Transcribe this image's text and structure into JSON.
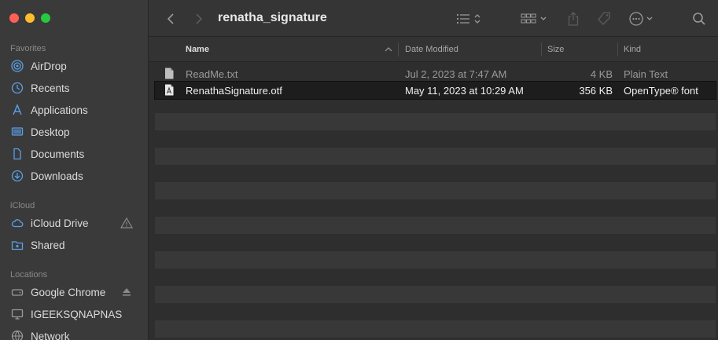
{
  "window": {
    "title": "renatha_signature"
  },
  "sidebar": {
    "sections": [
      {
        "title": "Favorites",
        "items": [
          {
            "label": "AirDrop",
            "icon": "airdrop-icon"
          },
          {
            "label": "Recents",
            "icon": "clock-icon"
          },
          {
            "label": "Applications",
            "icon": "applications-icon"
          },
          {
            "label": "Desktop",
            "icon": "desktop-icon"
          },
          {
            "label": "Documents",
            "icon": "document-icon"
          },
          {
            "label": "Downloads",
            "icon": "download-icon"
          }
        ]
      },
      {
        "title": "iCloud",
        "items": [
          {
            "label": "iCloud Drive",
            "icon": "cloud-icon"
          },
          {
            "label": "Shared",
            "icon": "shared-folder-icon"
          }
        ]
      },
      {
        "title": "Locations",
        "items": [
          {
            "label": "Google Chrome",
            "icon": "drive-icon"
          },
          {
            "label": "IGEEKSQNAPNAS",
            "icon": "monitor-icon"
          },
          {
            "label": "Network",
            "icon": "globe-icon"
          }
        ]
      }
    ]
  },
  "table": {
    "columns": {
      "name": "Name",
      "date": "Date Modified",
      "size": "Size",
      "kind": "Kind"
    },
    "rows": [
      {
        "name": "ReadMe.txt",
        "date": "Jul 2, 2023 at 7:47 AM",
        "size": "4 KB",
        "kind": "Plain Text",
        "selected": false
      },
      {
        "name": "RenathaSignature.otf",
        "date": "May 11, 2023 at 10:29 AM",
        "size": "356 KB",
        "kind": "OpenType® font",
        "selected": true
      }
    ]
  },
  "colors": {
    "close": "#ff5f57",
    "minimize": "#febc2e",
    "maximize": "#28c840",
    "sidebar_icon": "#5aa0e6"
  }
}
